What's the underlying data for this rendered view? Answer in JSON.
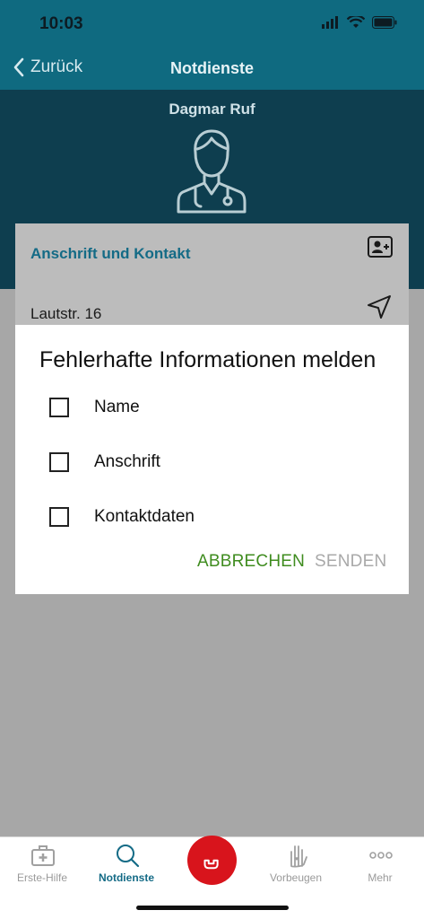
{
  "status": {
    "time": "10:03"
  },
  "nav": {
    "back_label": "Zurück",
    "title": "Notdienste"
  },
  "profile": {
    "name": "Dagmar Ruf"
  },
  "card": {
    "title": "Anschrift und Kontakt",
    "address": "Lautstr. 16"
  },
  "dialog": {
    "title": "Fehlerhafte Informationen melden",
    "options": [
      {
        "label": "Name",
        "checked": false
      },
      {
        "label": "Anschrift",
        "checked": false
      },
      {
        "label": "Kontaktdaten",
        "checked": false
      }
    ],
    "cancel_label": "ABBRECHEN",
    "send_label": "SENDEN",
    "accent_color": "#3f8c1f"
  },
  "tabs": [
    {
      "label": "Erste-Hilfe",
      "icon": "first-aid-kit-icon",
      "active": false
    },
    {
      "label": "Notdienste",
      "icon": "search-icon",
      "active": true
    },
    {
      "label": "",
      "icon": "phone-icon",
      "active": false
    },
    {
      "label": "Vorbeugen",
      "icon": "hand-heart-icon",
      "active": false
    },
    {
      "label": "Mehr",
      "icon": "more-icon",
      "active": false
    }
  ],
  "colors": {
    "header": "#0f6a80",
    "emergency": "#d8141c"
  }
}
